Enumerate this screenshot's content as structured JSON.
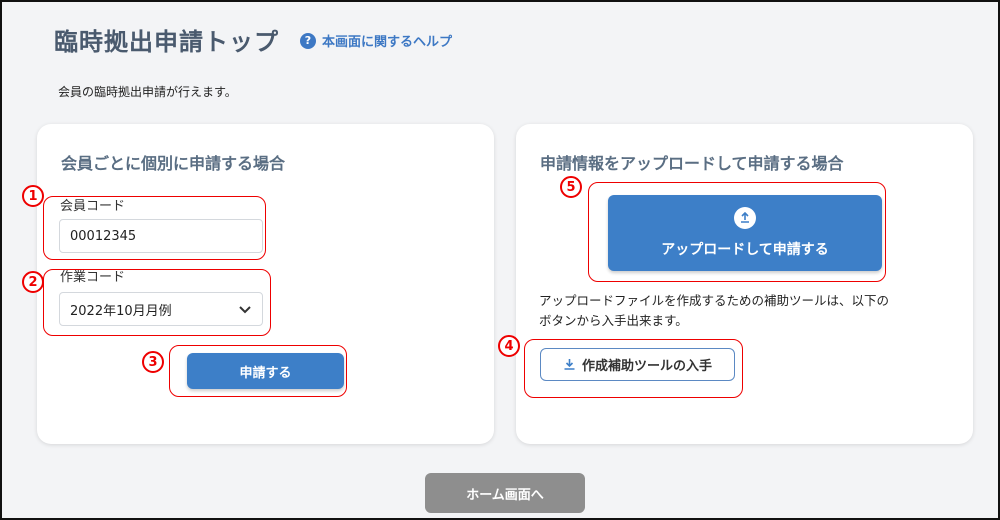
{
  "page": {
    "title": "臨時拠出申請トップ",
    "help_link": "本画面に関するヘルプ",
    "intro": "会員の臨時拠出申請が行えます。"
  },
  "individual": {
    "title": "会員ごとに個別に申請する場合",
    "member_code_label": "会員コード",
    "member_code_value": "00012345",
    "work_code_label": "作業コード",
    "work_code_value": "2022年10月月例",
    "submit_label": "申請する"
  },
  "upload": {
    "title": "申請情報をアップロードして申請する場合",
    "upload_button_label": "アップロードして申請する",
    "note_line1": "アップロードファイルを作成するための補助ツールは、以下の",
    "note_line2": "ボタンから入手出来ます。",
    "tool_button_label": "作成補助ツールの入手"
  },
  "footer": {
    "home_label": "ホーム画面へ"
  },
  "annotations": [
    "1",
    "2",
    "3",
    "4",
    "5"
  ],
  "colors": {
    "primary": "#3d7fc8",
    "annotation": "#ee0000",
    "home_button": "#8e8e8e"
  }
}
